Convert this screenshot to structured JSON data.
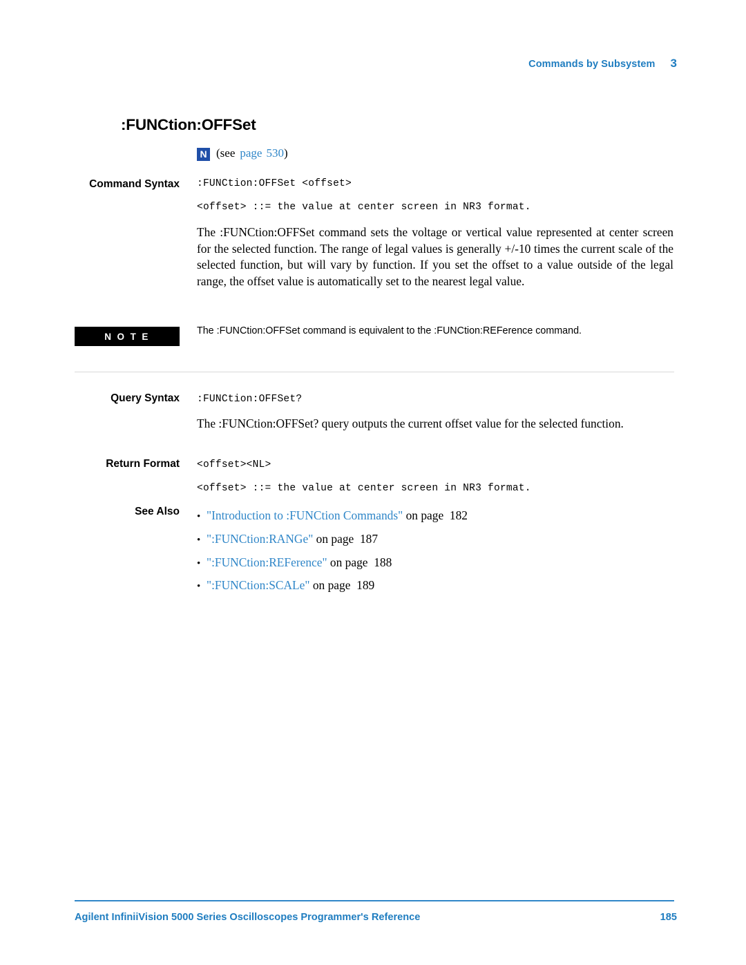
{
  "header": {
    "title": "Commands by Subsystem",
    "chapter": "3"
  },
  "command": {
    "title": ":FUNCtion:OFFSet",
    "badge": "N",
    "see_text": "(see",
    "see_link": "page",
    "see_page": "530",
    "see_close": ")"
  },
  "labels": {
    "command_syntax": "Command Syntax",
    "query_syntax": "Query Syntax",
    "return_format": "Return Format",
    "see_also": "See Also",
    "note": "N O T E"
  },
  "command_syntax": {
    "line1": ":FUNCtion:OFFSet <offset>",
    "line2": "<offset> ::= the value at center screen in NR3 format.",
    "description": "The :FUNCtion:OFFSet command sets the voltage or vertical value represented at center screen for the selected function. The range of legal values is generally +/-10 times the current scale of the selected function, but will vary by function. If you set the offset to a value outside of the legal range, the offset value is automatically set to the nearest legal value."
  },
  "note": {
    "text": "The :FUNCtion:OFFSet command is equivalent to the :FUNCtion:REFerence command."
  },
  "query_syntax": {
    "line1": ":FUNCtion:OFFSet?",
    "description": "The :FUNCtion:OFFSet? query outputs the current offset value for the selected function."
  },
  "return_format": {
    "line1": "<offset><NL>",
    "line2": "<offset> ::= the value at center screen in NR3 format."
  },
  "see_also": [
    {
      "link": "\"Introduction to :FUNCtion Commands\"",
      "suffix": "on page",
      "page": "182"
    },
    {
      "link": "\":FUNCtion:RANGe\"",
      "suffix": "on page",
      "page": "187"
    },
    {
      "link": "\":FUNCtion:REFerence\"",
      "suffix": "on page",
      "page": "188"
    },
    {
      "link": "\":FUNCtion:SCALe\"",
      "suffix": "on page",
      "page": "189"
    }
  ],
  "footer": {
    "left": "Agilent InfiniiVision 5000 Series Oscilloscopes Programmer's Reference",
    "right": "185"
  }
}
